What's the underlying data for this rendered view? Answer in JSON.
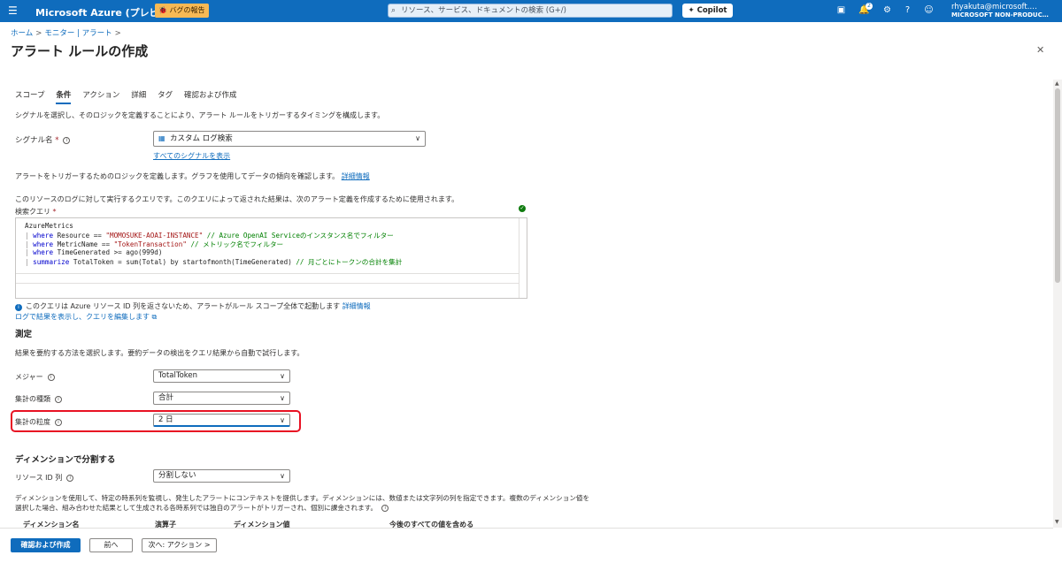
{
  "topbar": {
    "brand": "Microsoft Azure (プレビュー)",
    "bug_report": "バグの報告",
    "search_placeholder": "リソース、サービス、ドキュメントの検索 (G+/)",
    "copilot": "Copilot",
    "notification_count": "2",
    "user_name": "rhyakuta@microsoft.…",
    "tenant": "MICROSOFT NON-PRODUC…"
  },
  "breadcrumb": {
    "home": "ホーム",
    "monitor": "モニター | アラート"
  },
  "page": {
    "title": "アラート ルールの作成"
  },
  "tabs": [
    "スコープ",
    "条件",
    "アクション",
    "詳細",
    "タグ",
    "確認および作成"
  ],
  "intro_text": "シグナルを選択し、そのロジックを定義することにより、アラート ルールをトリガーするタイミングを構成します。",
  "signal": {
    "label": "シグナル名",
    "required_mark": "*",
    "value": "カスタム ログ検索",
    "show_all_link": "すべてのシグナルを表示"
  },
  "logic_text": "アラートをトリガーするためのロジックを定義します。グラフを使用してデータの傾向を確認します。",
  "logic_link": "詳細情報",
  "query_intro": "このリソースのログに対して実行するクエリです。このクエリによって返された結果は、次のアラート定義を作成するために使用されます。",
  "query_label": "検索クエリ",
  "query_required": "*",
  "query": {
    "l1": "AzureMetrics",
    "l2_kw": "where",
    "l2_a": " Resource == ",
    "l2_s": "\"MOMOSUKE-AOAI-INSTANCE\"",
    "l2_c": " // Azure OpenAI Serviceのインスタンス名でフィルター",
    "l3_kw": "where",
    "l3_a": " MetricName == ",
    "l3_s": "\"TokenTransaction\"",
    "l3_c": " // メトリック名でフィルター",
    "l4_kw": "where",
    "l4_a": " TimeGenerated >= ago(999d)",
    "l5_kw": "summarize",
    "l5_a": " TotalToken = sum(Total) by startofmonth(TimeGenerated)",
    "l5_c": " // 月ごとにトークンの合計を集計"
  },
  "query_note": "このクエリは Azure リソース ID 列を返さないため、アラートがルール スコープ全体で起動します",
  "query_note_link": "詳細情報",
  "view_logs_link": "ログで結果を表示し、クエリを編集します",
  "measurement": {
    "title": "測定",
    "desc": "結果を要約する方法を選択します。要約データの検出をクエリ結果から自動で試行します。",
    "measure_label": "メジャー",
    "measure_value": "TotalToken",
    "agg_type_label": "集計の種類",
    "agg_type_value": "合計",
    "granularity_label": "集計の粒度",
    "granularity_value": "2 日"
  },
  "dimension": {
    "title": "ディメンションで分割する",
    "resource_id_label": "リソース ID 列",
    "resource_id_value": "分割しない",
    "desc1": "ディメンションを使用して、特定の時系列を監視し、発生したアラートにコンテキストを提供します。ディメンションには、数値または文字列の列を指定できます。複数のディメンション値を",
    "desc2": "選択した場合、組み合わせた結果として生成される各時系列では独自のアラートがトリガーされ、個別に課金されます。",
    "col_name": "ディメンション名",
    "col_operator": "演算子",
    "col_value": "ディメンション値",
    "col_include": "今後のすべての値を含める"
  },
  "footer": {
    "review_create": "確認および作成",
    "previous": "前へ",
    "next": "次へ: アクション >"
  }
}
